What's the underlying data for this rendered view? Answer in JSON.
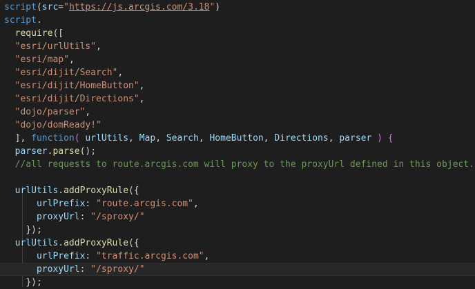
{
  "colors": {
    "background": "#1e1e1e",
    "tag": "#569cd6",
    "string": "#ce9178",
    "plain": "#d4d4d4",
    "property": "#9cdcfe",
    "function": "#dcdcaa",
    "keyword": "#569cd6",
    "comment": "#6a9955",
    "bracket_gold": "#ffd700",
    "bracket_purple": "#da70d6"
  },
  "lines": [
    [
      [
        "script",
        "tag"
      ],
      [
        "(",
        "plain"
      ],
      [
        "src",
        "property"
      ],
      [
        "=",
        "plain"
      ],
      [
        "\"",
        "string"
      ],
      [
        "https://js.arcgis.com/3.18",
        "string-link"
      ],
      [
        "\"",
        "string"
      ],
      [
        ")",
        "plain"
      ]
    ],
    [
      [
        "script",
        "tag"
      ],
      [
        ".",
        "plain"
      ]
    ],
    [
      [
        "  ",
        "plain"
      ],
      [
        "require",
        "function"
      ],
      [
        "([",
        "plain"
      ]
    ],
    [
      [
        "  ",
        "plain"
      ],
      [
        "\"esri/urlUtils\"",
        "string"
      ],
      [
        ",",
        "plain"
      ]
    ],
    [
      [
        "  ",
        "plain"
      ],
      [
        "\"esri/map\"",
        "string"
      ],
      [
        ",",
        "plain"
      ]
    ],
    [
      [
        "  ",
        "plain"
      ],
      [
        "\"esri/dijit/Search\"",
        "string"
      ],
      [
        ",",
        "plain"
      ]
    ],
    [
      [
        "  ",
        "plain"
      ],
      [
        "\"esri/dijit/HomeButton\"",
        "string"
      ],
      [
        ",",
        "plain"
      ]
    ],
    [
      [
        "  ",
        "plain"
      ],
      [
        "\"esri/dijit/Directions\"",
        "string"
      ],
      [
        ",",
        "plain"
      ]
    ],
    [
      [
        "  ",
        "plain"
      ],
      [
        "\"dojo/parser\"",
        "string"
      ],
      [
        ",",
        "plain"
      ]
    ],
    [
      [
        "  ",
        "plain"
      ],
      [
        "\"dojo/domReady!\"",
        "string"
      ]
    ],
    [
      [
        "  ",
        "plain"
      ],
      [
        "], ",
        "plain"
      ],
      [
        "function",
        "keyword"
      ],
      [
        "( ",
        "purple"
      ],
      [
        "urlUtils",
        "property"
      ],
      [
        ", ",
        "plain"
      ],
      [
        "Map",
        "property"
      ],
      [
        ", ",
        "plain"
      ],
      [
        "Search",
        "property"
      ],
      [
        ", ",
        "plain"
      ],
      [
        "HomeButton",
        "property"
      ],
      [
        ", ",
        "plain"
      ],
      [
        "Directions",
        "property"
      ],
      [
        ", ",
        "plain"
      ],
      [
        "parser",
        "property"
      ],
      [
        " ) ",
        "purple"
      ],
      [
        "{",
        "purple"
      ]
    ],
    [
      [
        "  ",
        "plain"
      ],
      [
        "parser",
        "property"
      ],
      [
        ".",
        "plain"
      ],
      [
        "parse",
        "function"
      ],
      [
        "();",
        "plain"
      ]
    ],
    [
      [
        "  ",
        "plain"
      ],
      [
        "//all requests to route.arcgis.com will proxy to the proxyUrl defined in this object.",
        "comment"
      ]
    ],
    [],
    [
      [
        "  ",
        "plain"
      ],
      [
        "urlUtils",
        "property"
      ],
      [
        ".",
        "plain"
      ],
      [
        "addProxyRule",
        "function"
      ],
      [
        "({",
        "plain"
      ]
    ],
    [
      [
        "      ",
        "plain"
      ],
      [
        "urlPrefix",
        "property"
      ],
      [
        ": ",
        "plain"
      ],
      [
        "\"route.arcgis.com\"",
        "string"
      ],
      [
        ",",
        "plain"
      ]
    ],
    [
      [
        "      ",
        "plain"
      ],
      [
        "proxyUrl",
        "property"
      ],
      [
        ": ",
        "plain"
      ],
      [
        "\"/sproxy/\"",
        "string"
      ]
    ],
    [
      [
        "    ",
        "plain"
      ],
      [
        "});",
        "plain"
      ]
    ],
    [
      [
        "  ",
        "plain"
      ],
      [
        "urlUtils",
        "property"
      ],
      [
        ".",
        "plain"
      ],
      [
        "addProxyRule",
        "function"
      ],
      [
        "({",
        "plain"
      ]
    ],
    [
      [
        "      ",
        "plain"
      ],
      [
        "urlPrefix",
        "property"
      ],
      [
        ": ",
        "plain"
      ],
      [
        "\"traffic.arcgis.com\"",
        "string"
      ],
      [
        ",",
        "plain"
      ]
    ],
    [
      [
        "      ",
        "plain"
      ],
      [
        "proxyUrl",
        "property"
      ],
      [
        ": ",
        "plain"
      ],
      [
        "\"/sproxy/\"",
        "string"
      ]
    ],
    [
      [
        "    ",
        "plain"
      ],
      [
        "});",
        "plain"
      ]
    ]
  ],
  "current_line": 20
}
